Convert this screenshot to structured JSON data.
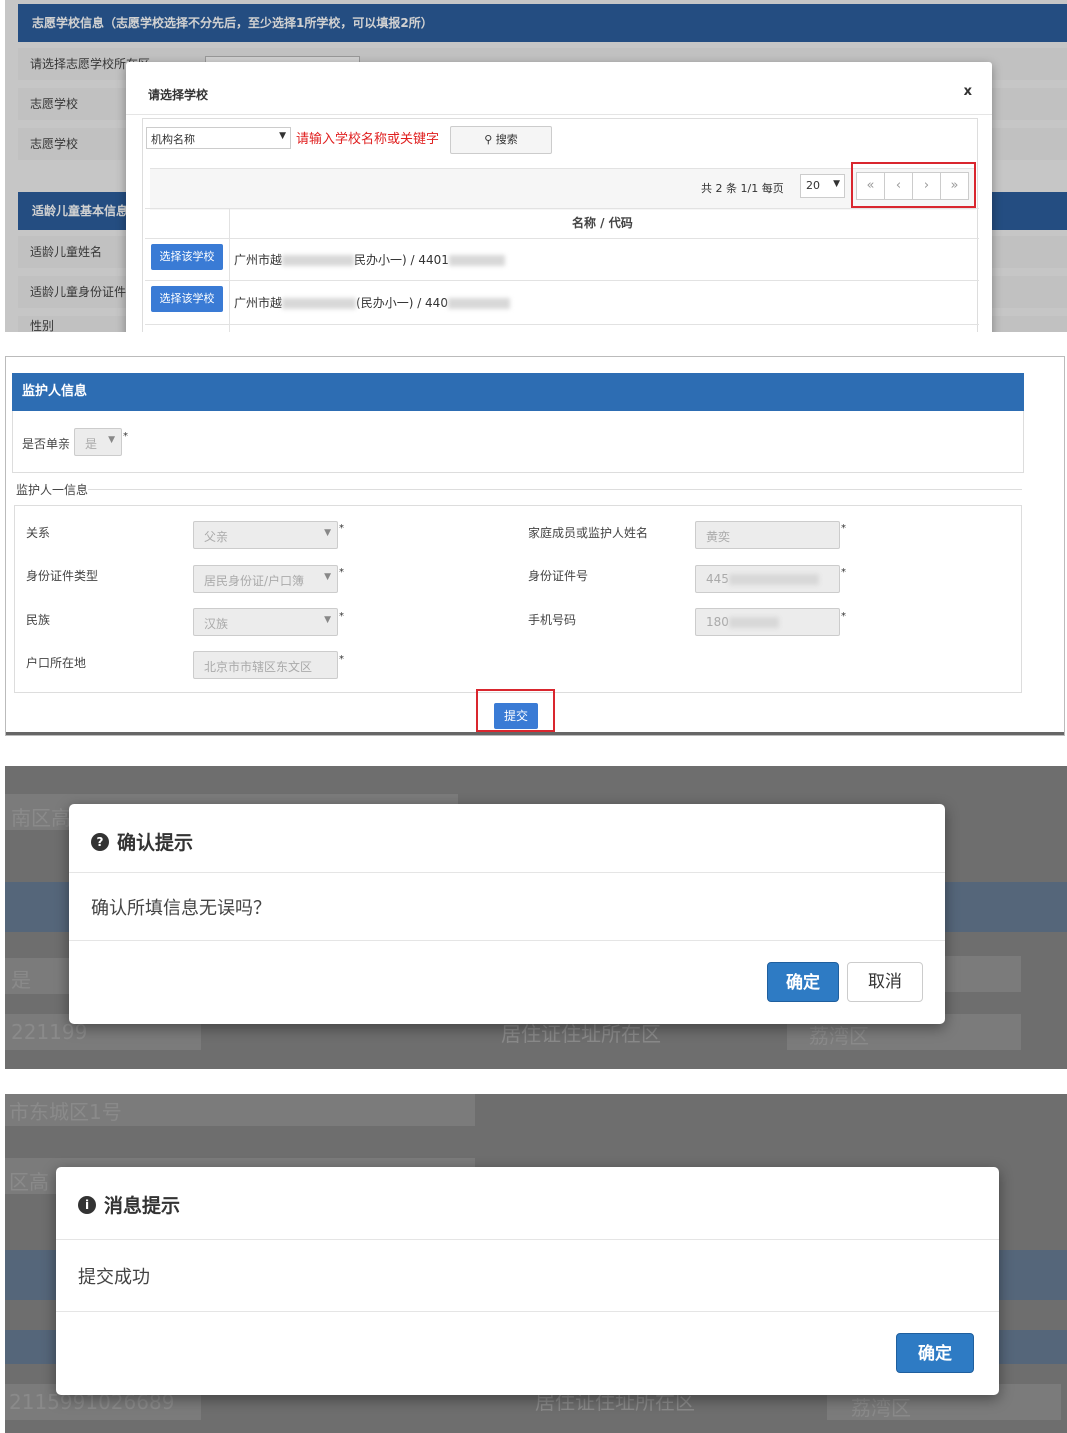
{
  "panel1": {
    "bg_header": "志愿学校信息（志愿学校选择不分先后，至少选择1所学校，可以填报2所）",
    "bg_rows": [
      "请选择志愿学校所在区",
      "志愿学校",
      "志愿学校"
    ],
    "bg_header2": "适龄儿童基本信息",
    "bg_rows2": [
      "适龄儿童姓名",
      "适龄儿童身份证件",
      "性别"
    ],
    "modal_title": "请选择学校",
    "close": "x",
    "select_value": "机构名称",
    "search_placeholder": "请输入学校名称或关键字",
    "search_button": "搜索",
    "pager_info": "共 2 条  1/1  每页",
    "per_page": "20",
    "pager_buttons": [
      "«",
      "‹",
      "›",
      "»"
    ],
    "column_header": "名称 / 代码",
    "rows": [
      {
        "button": "选择该学校",
        "name_prefix": "广州市越",
        "name_suffix": "民办小一) / 4401"
      },
      {
        "button": "选择该学校",
        "name_prefix": "广州市越",
        "name_suffix": "(民办小一) / 440"
      }
    ]
  },
  "panel2": {
    "header": "监护人信息",
    "single_parent_label": "是否单亲",
    "single_parent_value": "是",
    "group_label": "监护人一信息",
    "left_fields": [
      {
        "label": "关系",
        "value": "父亲"
      },
      {
        "label": "身份证件类型",
        "value": "居民身份证/户口簿"
      },
      {
        "label": "民族",
        "value": "汉族"
      },
      {
        "label": "户口所在地",
        "value": "北京市市辖区东文区"
      }
    ],
    "right_fields": [
      {
        "label": "家庭成员或监护人姓名",
        "value": "黄奕"
      },
      {
        "label": "身份证件号",
        "value": "445"
      },
      {
        "label": "手机号码",
        "value": "180"
      }
    ],
    "submit": "提交"
  },
  "panel3": {
    "title": "确认提示",
    "message": "确认所填信息无误吗？",
    "ok": "确定",
    "cancel": "取消",
    "bg_texts": [
      "南区高",
      "是",
      "221199",
      "居住证住址所在区",
      "荔湾区"
    ]
  },
  "panel4": {
    "title": "消息提示",
    "message": "提交成功",
    "ok": "确定",
    "bg_texts": [
      "市东城区1号",
      "区高",
      "2115991026689",
      "居住证住址所在区",
      "荔湾区"
    ]
  },
  "colors": {
    "header_blue": "#2d6db3",
    "button_blue": "#3a7bd5",
    "highlight_red": "#d9262e"
  }
}
